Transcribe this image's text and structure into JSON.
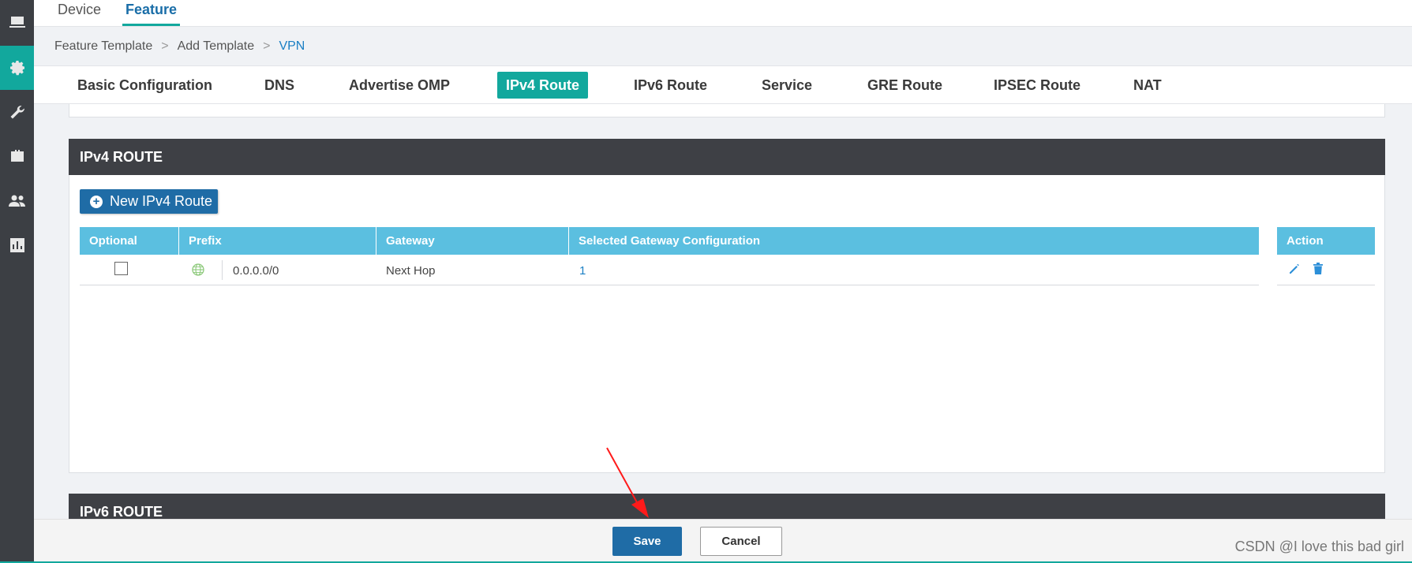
{
  "top_tabs": [
    "Device",
    "Feature"
  ],
  "breadcrumb": [
    "Feature Template",
    "Add Template",
    "VPN"
  ],
  "breadcrumb_sep": ">",
  "section_tabs": [
    "Basic Configuration",
    "DNS",
    "Advertise OMP",
    "IPv4 Route",
    "IPv6 Route",
    "Service",
    "GRE Route",
    "IPSEC Route",
    "NAT"
  ],
  "active_section_tab": "IPv4 Route",
  "ipv4_section": {
    "title": "IPv4 ROUTE",
    "new_button": "New IPv4 Route",
    "columns": [
      "Optional",
      "Prefix",
      "Gateway",
      "Selected Gateway Configuration",
      "Action"
    ],
    "rows": [
      {
        "optional": false,
        "prefix": "0.0.0.0/0",
        "gateway": "Next Hop",
        "selected_config": "1"
      }
    ]
  },
  "ipv6_section": {
    "title": "IPv6 ROUTE"
  },
  "footer": {
    "save_label": "Save",
    "cancel_label": "Cancel"
  },
  "watermark": "CSDN @I love this bad girl",
  "colors": {
    "accent": "#12a89d",
    "primary": "#1f6ca6",
    "table_header": "#5bbfe0",
    "section_header": "#3e4045"
  }
}
